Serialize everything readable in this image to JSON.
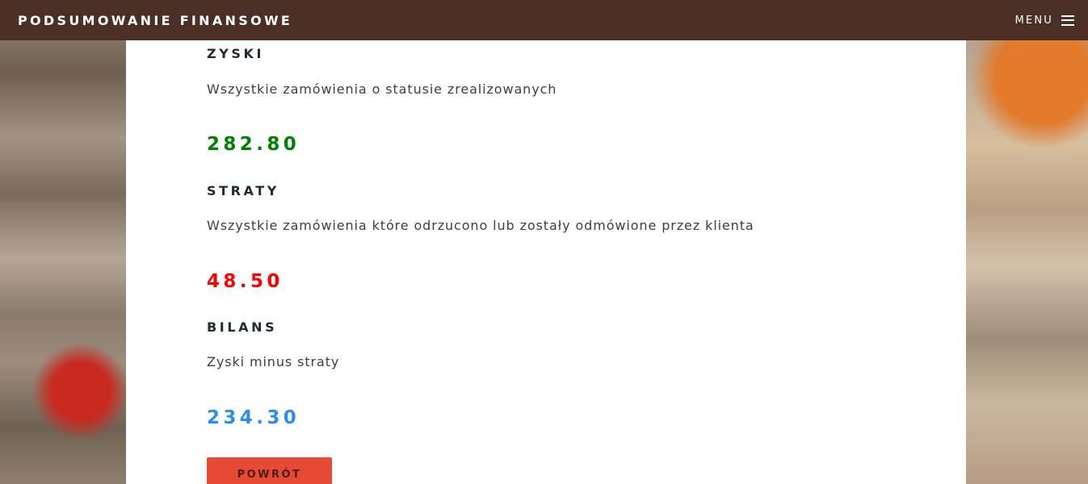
{
  "navbar": {
    "brand": "PODSUMOWANIE FINANSOWE",
    "menu_label": "MENU",
    "menu_icon": "hamburger-icon",
    "background_color": "#4a2f26"
  },
  "sections": [
    {
      "heading": "ZYSKI",
      "description": "Wszystkie zamówienia o statusie zrealizowanych",
      "value": "282.80",
      "value_color": "#008000"
    },
    {
      "heading": "STRATY",
      "description": "Wszystkie zamówienia które odrzucono lub zostały odmówione przez klienta",
      "value": "48.50",
      "value_color": "#ff0000"
    },
    {
      "heading": "BILANS",
      "description": "Zyski minus straty",
      "value": "234.30",
      "value_color": "#2a8ef0"
    }
  ],
  "back_button": {
    "label": "POWRÓT",
    "color": "#e64a35"
  }
}
